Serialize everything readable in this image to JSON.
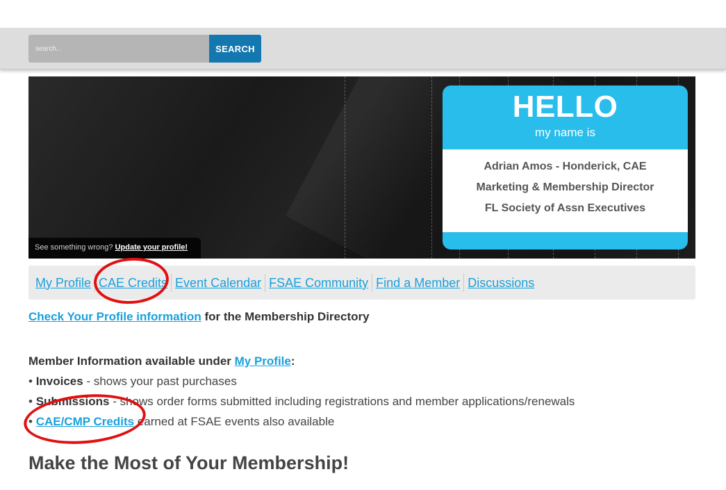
{
  "search": {
    "placeholder": "search...",
    "button_label": "SEARCH"
  },
  "banner": {
    "note_text": "See something wrong?",
    "note_link": "Update your profile!",
    "badge": {
      "hello": "HELLO",
      "subtitle": "my name is",
      "name": "Adrian Amos - Honderick, CAE",
      "title": "Marketing & Membership Director",
      "organization": "FL Society of Assn Executives"
    }
  },
  "nav": {
    "items": [
      {
        "label": "My Profile"
      },
      {
        "label": "CAE Credits"
      },
      {
        "label": "Event Calendar"
      },
      {
        "label": "FSAE Community"
      },
      {
        "label": "Find a Member"
      },
      {
        "label": "Discussions"
      }
    ]
  },
  "content": {
    "profile_check_link": "Check Your Profile information",
    "profile_check_text": " for the Membership Directory",
    "member_info_text": "Member Information available under ",
    "member_info_link": "My Profile",
    "member_info_colon": ":",
    "bullet": "• ",
    "invoices_label": "Invoices",
    "invoices_text": " - shows your past purchases",
    "submissions_label": "Submissions",
    "submissions_text": " - shows order forms submitted including registrations and member applications/renewals",
    "credits_link": "CAE/CMP Credits",
    "credits_text": " earned at FSAE events also available",
    "heading": "Make the Most of Your Membership!"
  },
  "colors": {
    "accent_blue": "#1aa0dc",
    "search_button": "#1478b0",
    "badge_blue": "#29bdec",
    "annotation_red": "#e01010"
  }
}
